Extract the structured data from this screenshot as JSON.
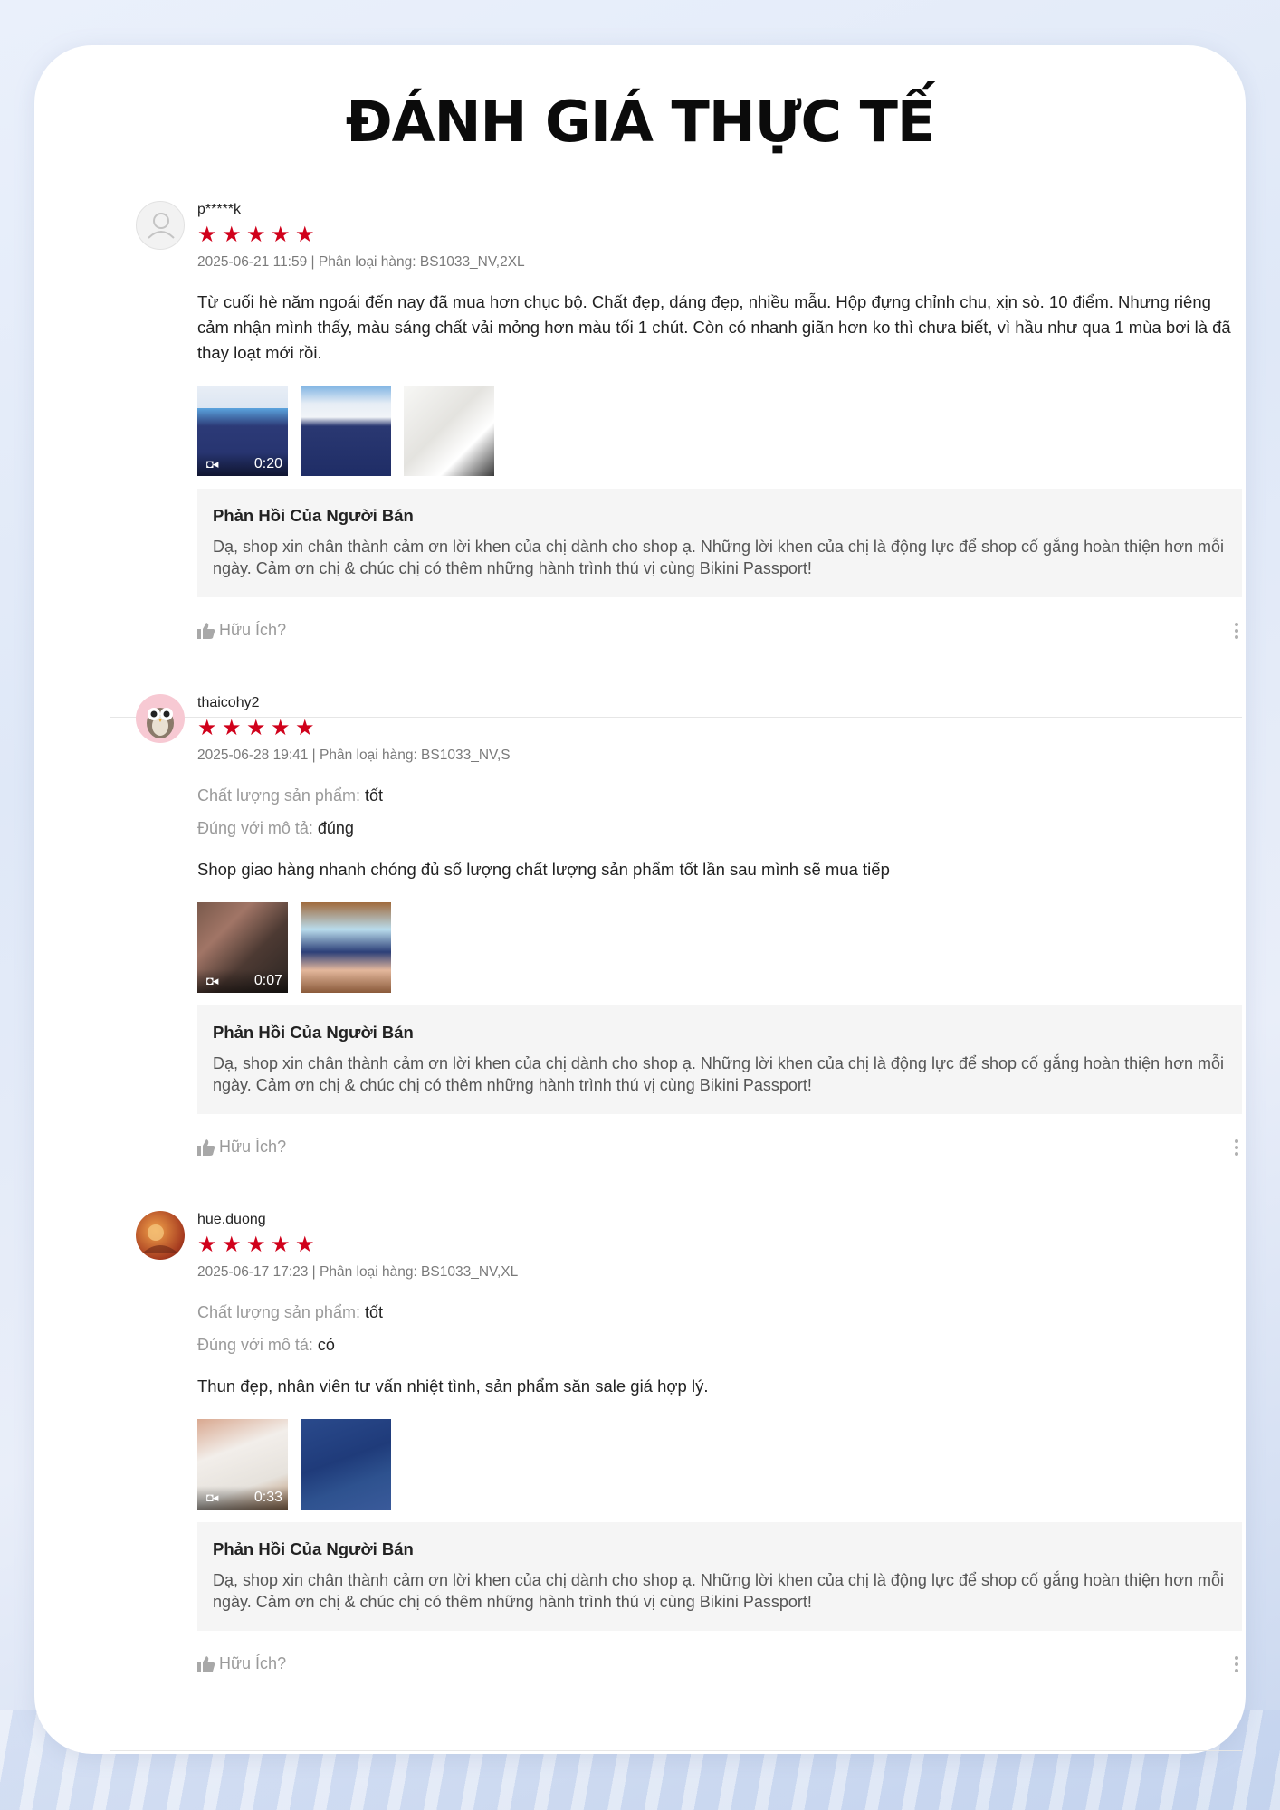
{
  "page_title": "ĐÁNH GIÁ THỰC TẾ",
  "reviews": [
    {
      "username": "p*****k",
      "stars": "★★★★★",
      "meta": "2025-06-21 11:59 | Phân loại hàng: BS1033_NV,2XL",
      "body": "Từ cuối hè năm ngoái đến nay đã mua hơn chục bộ. Chất đẹp, dáng đẹp, nhiều mẫu. Hộp đựng chỉnh chu, xịn sò. 10 điểm. Nhưng riêng cảm nhận mình thấy, màu sáng chất vải mỏng hơn màu tối 1 chút. Còn có nhanh giãn hơn ko thì chưa biết, vì hầu như qua 1 mùa bơi là đã thay loạt mới rồi.",
      "video_duration": "0:20",
      "seller_reply_title": "Phản Hồi Của Người Bán",
      "seller_reply": "Dạ, shop xin chân thành cảm ơn lời khen của chị dành cho shop ạ. Những lời khen của chị là động lực để shop cố gắng hoàn thiện hơn mỗi ngày. Cảm ơn chị & chúc chị có thêm những hành trình thú vị cùng Bikini Passport!",
      "helpful": "Hữu Ích?"
    },
    {
      "username": "thaicohy2",
      "stars": "★★★★★",
      "meta": "2025-06-28 19:41 | Phân loại hàng: BS1033_NV,S",
      "quality_label": "Chất lượng sản phẩm: ",
      "quality_value": "tốt",
      "desc_label": "Đúng với mô tả: ",
      "desc_value": "đúng",
      "body": "Shop giao hàng nhanh chóng đủ số lượng chất lượng sản phẩm tốt lần sau mình sẽ mua tiếp",
      "video_duration": "0:07",
      "seller_reply_title": "Phản Hồi Của Người Bán",
      "seller_reply": "Dạ, shop xin chân thành cảm ơn lời khen của chị dành cho shop ạ. Những lời khen của chị là động lực để shop cố gắng hoàn thiện hơn mỗi ngày. Cảm ơn chị & chúc chị có thêm những hành trình thú vị cùng Bikini Passport!",
      "helpful": "Hữu Ích?"
    },
    {
      "username": "hue.duong",
      "stars": "★★★★★",
      "meta": "2025-06-17 17:23 | Phân loại hàng: BS1033_NV,XL",
      "quality_label": "Chất lượng sản phẩm: ",
      "quality_value": "tốt",
      "desc_label": "Đúng với mô tả: ",
      "desc_value": "có",
      "body": "Thun đẹp, nhân viên tư vấn nhiệt tình, sản phẩm săn sale giá hợp lý.",
      "video_duration": "0:33",
      "seller_reply_title": "Phản Hồi Của Người Bán",
      "seller_reply": "Dạ, shop xin chân thành cảm ơn lời khen của chị dành cho shop ạ. Những lời khen của chị là động lực để shop cố gắng hoàn thiện hơn mỗi ngày. Cảm ơn chị & chúc chị có thêm những hành trình thú vị cùng Bikini Passport!",
      "helpful": "Hữu Ích?"
    }
  ],
  "colors": {
    "star": "#d0011b",
    "seller_box_bg": "#f5f5f5",
    "muted_text": "#9a9a9a"
  },
  "icons": {
    "video": "video-camera-icon",
    "helpful": "thumbs-up-icon",
    "more": "more-vertical-icon",
    "avatar_default": "user-icon"
  }
}
